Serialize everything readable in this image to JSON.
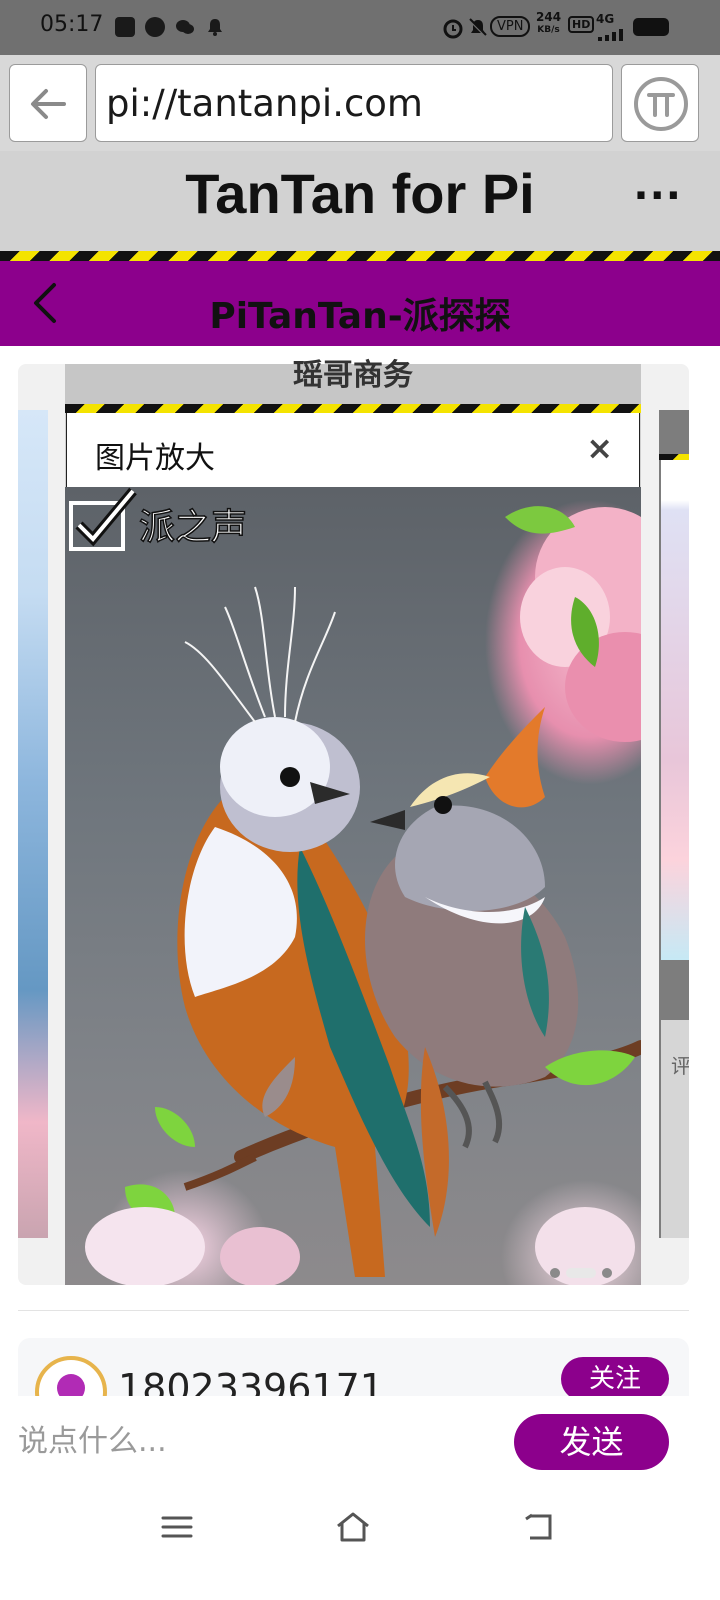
{
  "status_bar": {
    "time": "05:17",
    "vpn_label": "VPN",
    "speed_value": "244",
    "speed_unit": "KB/s",
    "hd_label": "HD",
    "network_label": "4G"
  },
  "url_bar": {
    "url": "pi://tantanpi.com",
    "back_icon": "back-arrow-icon",
    "pi_icon": "pi-logo-icon"
  },
  "header": {
    "title": "TanTan for Pi",
    "more_label": "···"
  },
  "sub_header": {
    "title": "PiTanTan-派探探",
    "back_icon": "chevron-left-icon"
  },
  "modal": {
    "peek_title": "瑶哥商务",
    "title": "图片放大",
    "close_label": "×",
    "watermark": "派之声"
  },
  "carousel": {
    "dot_count": 3,
    "active_index": 1,
    "right_card_label": "评"
  },
  "post": {
    "user_name": "18023396171",
    "follow_label": "关注"
  },
  "comment": {
    "placeholder": "说点什么...",
    "send_label": "发送"
  },
  "nav": {
    "menu_icon": "menu-icon",
    "home_icon": "home-icon",
    "back_icon": "back-icon"
  },
  "colors": {
    "accent": "#8c008c",
    "hazard_yellow": "#f4e300",
    "hazard_black": "#111111"
  }
}
